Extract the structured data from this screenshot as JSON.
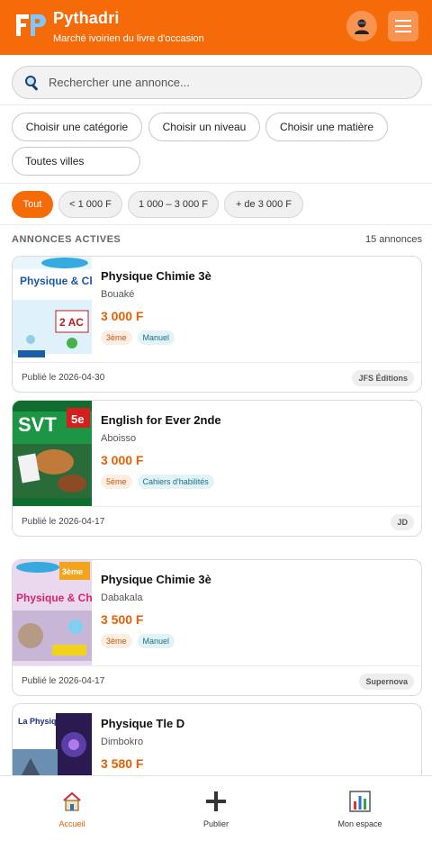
{
  "header": {
    "app_name": "Pythadri",
    "tagline": "Marché ivoirien du livre d'occasion",
    "logo_text": "FP",
    "brand_color": "#f56b0a",
    "avatar_icon": "user-avatar-icon",
    "menu_icon": "hamburger-menu-icon"
  },
  "search": {
    "placeholder": "Rechercher une annonce...",
    "icon": "search-icon"
  },
  "filters": {
    "category": "Choisir une catégorie",
    "level": "Choisir un niveau",
    "subject": "Choisir une matière",
    "city": "Toutes villes"
  },
  "price_filters": [
    {
      "label": "Tout",
      "active": true
    },
    {
      "label": "< 1 000 F",
      "active": false
    },
    {
      "label": "1 000 – 3 000 F",
      "active": false
    },
    {
      "label": "+ de 3 000 F",
      "active": false
    }
  ],
  "listings_header": {
    "label": "ANNONCES ACTIVES",
    "count": "15 annonces"
  },
  "listings": [
    {
      "title": "Physique Chimie 3è",
      "city": "Bouaké",
      "price": "3 000 F",
      "level": "3ème",
      "type": "Manuel",
      "date": "Publié le 2026-04-30",
      "publisher": "JFS Éditions",
      "cover_title": "Physique & Chimie",
      "cover_tag": "2 AC"
    },
    {
      "title": "English for Ever 2nde",
      "city": "Aboisso",
      "price": "3 000 F",
      "level": "5ème",
      "type": "Cahiers d'habilités",
      "date": "Publié le 2026-04-17",
      "publisher": "JD",
      "cover_title": "SVT",
      "cover_tag": "5e"
    },
    {
      "title": "Physique Chimie 3è",
      "city": "Dabakala",
      "price": "3 500 F",
      "level": "3ème",
      "type": "Manuel",
      "date": "Publié le 2026-04-17",
      "publisher": "Supernova",
      "cover_title": "Physique & Chimie",
      "cover_tag": "3ème"
    },
    {
      "title": "Physique Tle D",
      "city": "Dimbokro",
      "price": "3 580 F",
      "level": "",
      "type": "",
      "date": "",
      "publisher": "",
      "cover_title": "La Physique",
      "cover_tag": ""
    }
  ],
  "bottom_nav": [
    {
      "label": "Accueil",
      "icon": "home-icon",
      "active": true
    },
    {
      "label": "Publier",
      "icon": "plus-icon",
      "active": false
    },
    {
      "label": "Mon espace",
      "icon": "bar-chart-icon",
      "active": false
    }
  ]
}
